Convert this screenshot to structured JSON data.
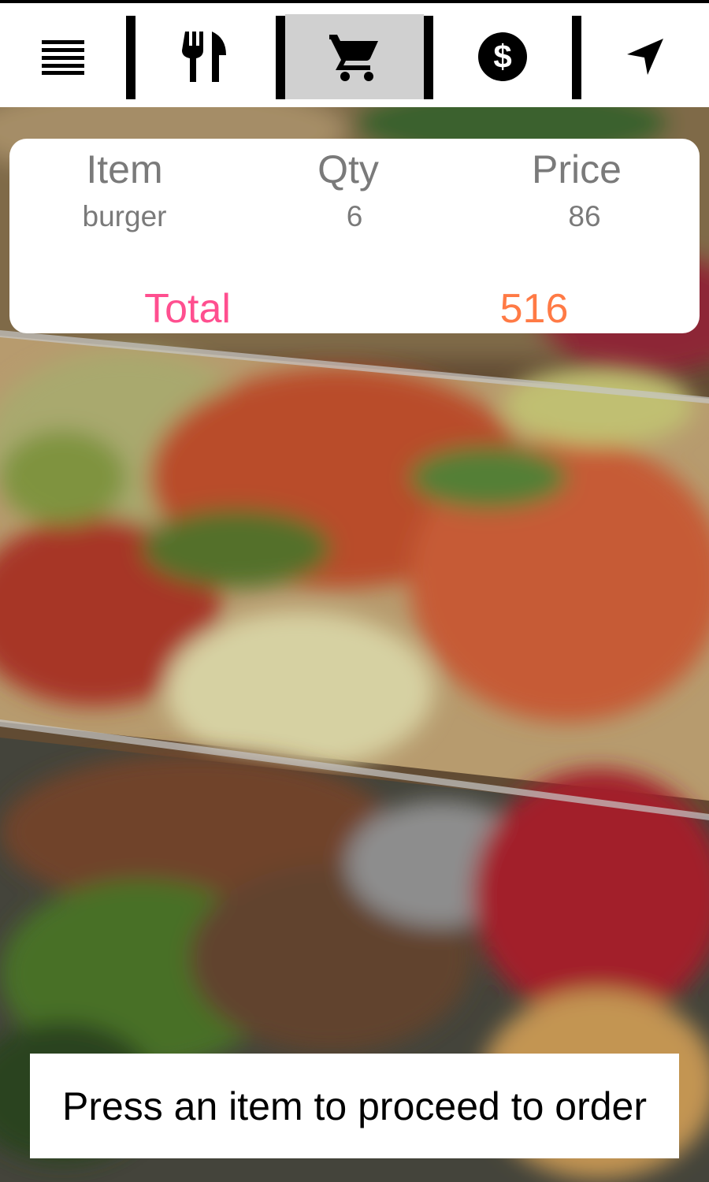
{
  "toolbar": {
    "items": [
      {
        "icon": "menu-icon",
        "active": false
      },
      {
        "icon": "fork-knife-icon",
        "active": false
      },
      {
        "icon": "cart-icon",
        "active": true
      },
      {
        "icon": "dollar-icon",
        "active": false
      },
      {
        "icon": "navigation-arrow-icon",
        "active": false
      }
    ]
  },
  "order": {
    "headers": {
      "item": "Item",
      "qty": "Qty",
      "price": "Price"
    },
    "rows": [
      {
        "item": "burger",
        "qty": "6",
        "price": "86"
      }
    ],
    "total_label": "Total",
    "total_value": "516"
  },
  "hint": {
    "text": "Press an item to proceed to order"
  },
  "colors": {
    "total_label": "#ff4f8f",
    "total_value": "#ff7a45",
    "active_tab_bg": "#d0d0d0",
    "muted_text": "#7a7a7a"
  }
}
